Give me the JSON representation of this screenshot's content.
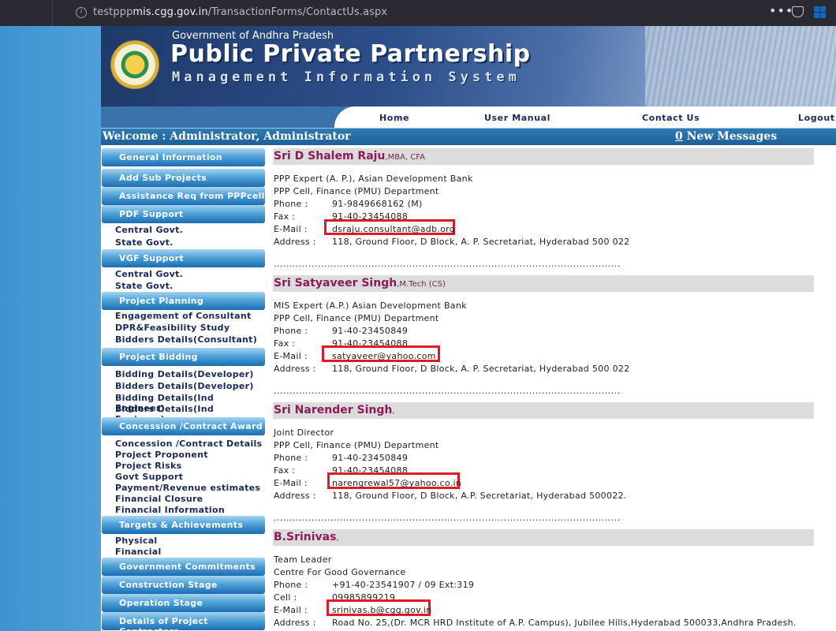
{
  "browser": {
    "url_prefix": "testppp",
    "url_host": "mis.cgg.gov.in",
    "url_path": "/TransactionForms/ContactUs.aspx",
    "menu_glyph": "•••"
  },
  "header": {
    "gov_line": "Government of Andhra Pradesh",
    "title": "Public Private Partnership",
    "subtitle": "Management Information System"
  },
  "nav": {
    "home": "Home",
    "user_manual": "User Manual",
    "contact_us": "Contact Us",
    "logout": "Logout"
  },
  "welcome": {
    "text": "Welcome : Administrator, Administrator",
    "message_count": "0",
    "message_label": " New Messages"
  },
  "sidebar": {
    "general_information": "General Information",
    "add_sub_projects": "Add Sub Projects",
    "assistance_req": "Assistance Req from PPPcell",
    "pdf_support": "PDF Support",
    "pdf_central": "Central Govt.",
    "pdf_state": "State Govt.",
    "vgf_support": "VGF Support",
    "vgf_central": "Central Govt.",
    "vgf_state": "State Govt.",
    "project_planning": "Project Planning",
    "engagement": "Engagement of Consultant",
    "dpr": "DPR&Feasibility Study",
    "bidders_consultant": "Bidders Details(Consultant)",
    "project_bidding": "Project Bidding",
    "bidding_developer": "Bidding Details(Developer)",
    "bidders_developer": "Bidders Details(Developer)",
    "bidding_ind": "Bidding Details(Ind Engineer)",
    "bidders_ind": "Bidders Details(Ind Engineer)",
    "concession_award": "Concession /Contract Award",
    "concession_details": "Concession /Contract Details",
    "project_proponent": "Project Proponent",
    "project_risks": "Project Risks",
    "govt_support": "Govt Support",
    "payment_revenue": "Payment/Revenue estimates",
    "financial_closure": "Financial Closure",
    "financial_information": "Financial Information",
    "targets": "Targets & Achievements",
    "physical": "Physical",
    "financial": "Financial",
    "gov_commitments": "Government Commitments",
    "construction_stage": "Construction Stage",
    "operation_stage": "Operation Stage",
    "project_contractors": "Details of Project Contractors"
  },
  "labels": {
    "phone": "Phone :",
    "fax": "Fax :",
    "cell": "Cell :",
    "email": "E-Mail :",
    "address": "Address :"
  },
  "dots": "...................................................................................................................................................",
  "contacts": [
    {
      "name": "Sri D Shalem Raju",
      "quals": ",MBA, CFA",
      "line1": "PPP Expert (A. P.), Asian Development Bank",
      "line2": "PPP Cell, Finance (PMU) Department",
      "phone": "91-9849668162 (M)",
      "fax": "91-40-23454088",
      "email": "dsraju.consultant@adb.org",
      "address": "118, Ground Floor, D Block, A. P. Secretariat, Hyderabad 500 022"
    },
    {
      "name": "Sri Satyaveer Singh",
      "quals": ",M.Tech (CS)",
      "line1": "MIS Expert (A.P.) Asian Development Bank",
      "line2": "PPP Cell, Finance (PMU) Department",
      "phone": "91-40-23450849",
      "fax": "91-40-23454088",
      "email": "satyaveer@yahoo.com",
      "address": "118, Ground Floor, D Block, A. P. Secretariat, Hyderabad 500 022"
    },
    {
      "name": "Sri Narender Singh",
      "quals": ",",
      "line1": "Joint Director",
      "line2": "PPP Cell, Finance (PMU) Department",
      "phone": "91-40-23450849",
      "fax": "91-40-23454088",
      "email": "narengrewal57@yahoo.co.in",
      "address": "118, Ground Floor, D Block, A.P. Secretariat, Hyderabad 500022."
    },
    {
      "name": "B.Srinivas",
      "quals": ",",
      "line1": "Team Leader",
      "line2": "Centre For Good Governance",
      "phone": "+91-40-23541907 / 09 Ext:319",
      "cell": "09985899219",
      "email": "srinivas.b@cgg.gov.in",
      "address": "Road No. 25,(Dr. MCR HRD Institute of A.P. Campus), Jubilee Hills,Hyderabad 500033,Andhra Pradesh."
    }
  ]
}
